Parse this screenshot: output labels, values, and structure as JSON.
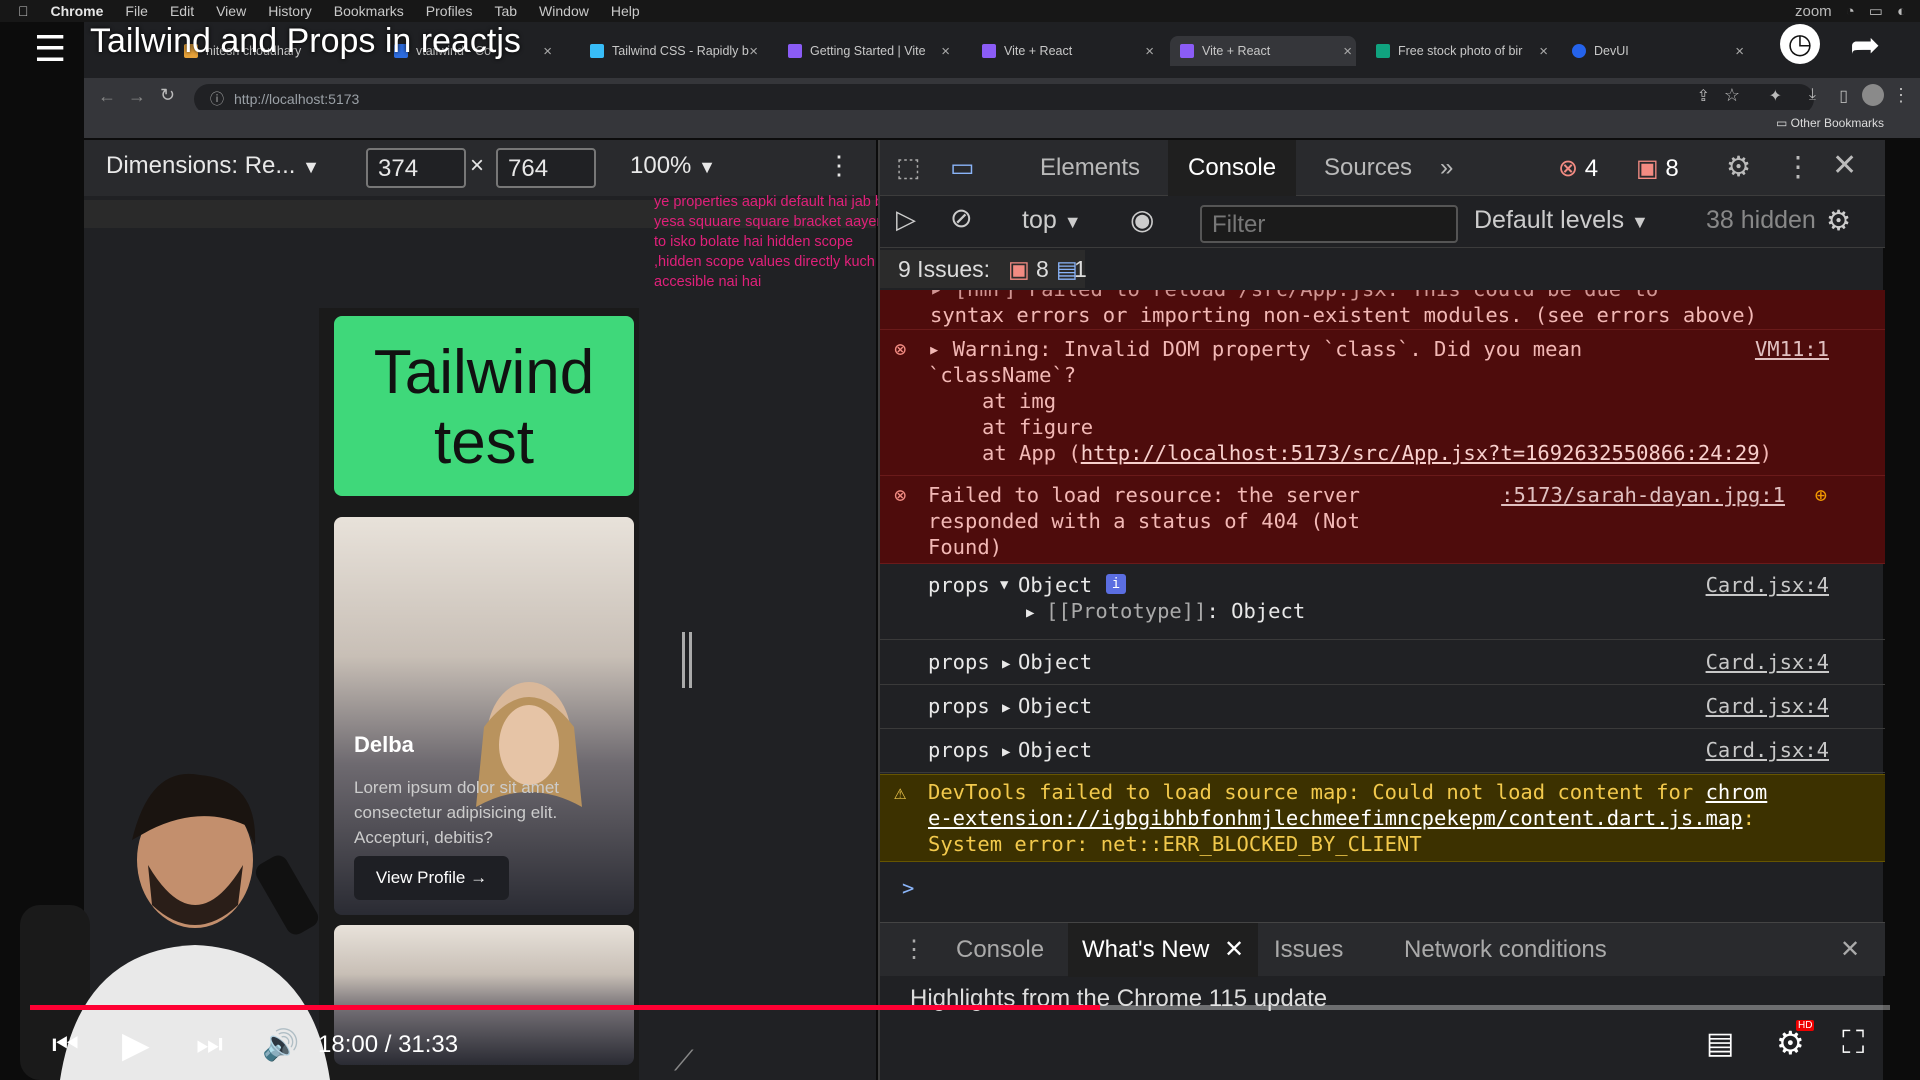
{
  "macmenu": {
    "app": "Chrome",
    "items": [
      "File",
      "Edit",
      "View",
      "History",
      "Bookmarks",
      "Profiles",
      "Tab",
      "Window",
      "Help"
    ],
    "zoom": "zoom"
  },
  "video": {
    "title": "Tailwind and Props in reactjs",
    "time": "18:00 / 31:33",
    "progress_fraction": 0.575,
    "hd": "HD"
  },
  "tabs": [
    {
      "label": "hitesh choudhary",
      "color": "#e8a33a"
    },
    {
      "label": "vtailwind - Co",
      "color": "#2d6cdf"
    },
    {
      "label": "Tailwind CSS - Rapidly b",
      "color": "#38bdf8"
    },
    {
      "label": "Getting Started | Vite",
      "color": "#8b5cf6"
    },
    {
      "label": "Vite + React",
      "color": "#8b5cf6"
    },
    {
      "label": "Vite + React",
      "color": "#8b5cf6"
    },
    {
      "label": "Free stock photo of bir",
      "color": "#10a37f"
    },
    {
      "label": "DevUI",
      "color": "#2563eb"
    }
  ],
  "url": "http://localhost:5173",
  "bookmarks": {
    "other": "Other Bookmarks"
  },
  "device": {
    "dimensions_label": "Dimensions: Re...",
    "width": "374",
    "times": "×",
    "height": "764",
    "zoom": "100%"
  },
  "annotation": "ye properties aapki default hai jab bhi yesa squuare square bracket aayena  to isko bolate hai hidden scope ,hidden scope values directly kuch bhi accesible nai hai",
  "page": {
    "tailwind_card": "Tailwind test",
    "profile": {
      "name": "Delba",
      "desc": "Lorem ipsum dolor sit amet consectetur adipisicing elit. Accepturi, debitis?",
      "button": "View Profile →"
    }
  },
  "devtools": {
    "tabs": [
      "Elements",
      "Console",
      "Sources"
    ],
    "error_count": "4",
    "issue_count": "8",
    "context": "top",
    "filter_placeholder": "Filter",
    "levels": "Default levels",
    "hidden": "38 hidden",
    "issues_label": "9 Issues:",
    "issues_errors": "8",
    "issues_info": "1"
  },
  "console": {
    "e0_text": "syntax errors or importing non-existent modules. (see errors above)",
    "e0_partial": "▸ [hmr] Failed to reload /src/App.jsx. This could be due to",
    "e0_src": "VM11:1",
    "e1_line1": "▸ Warning: Invalid DOM property `class`. Did you mean",
    "e1_line2": "`className`?",
    "e1_line3": "at img",
    "e1_line4": "at figure",
    "e1_line5a": "at App (",
    "e1_link": "http://localhost:5173/src/App.jsx?t=1692632550866:24:29",
    "e1_line5b": ")",
    "e1_src": "VM11:1",
    "e2_line1": "Failed to load resource: the server",
    "e2_line2": "responded with a status of 404 (Not",
    "e2_line3": "Found)",
    "e2_src": ":5173/sarah-dayan.jpg:1",
    "log_key": "props",
    "log_obj": "Object",
    "proto": "[[Prototype]]",
    "proto_val": ": Object",
    "log_src": "Card.jsx:4",
    "w_line1": "DevTools failed to load source map: Could not load content for ",
    "w_link1": "chrom",
    "w_link2": "e-extension://igbgibhbfonhmjlechmeefimncpekepm/content.dart.js.map",
    "w_line2b": ":",
    "w_line3": "System error: net::ERR_BLOCKED_BY_CLIENT",
    "prompt": ">"
  },
  "drawer": {
    "tabs": [
      "Console",
      "What's New",
      "Issues",
      "Network conditions"
    ],
    "highlights": "Highlights from the Chrome 115 update"
  }
}
